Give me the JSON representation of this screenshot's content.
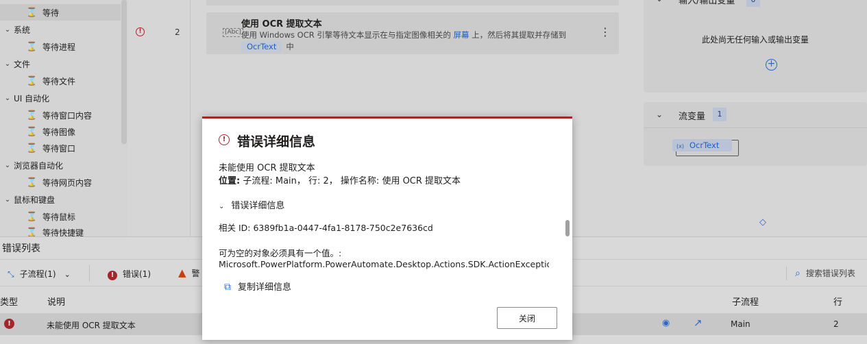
{
  "actions_tree": {
    "items": [
      {
        "type": "item",
        "label": "等待",
        "icon": "hourglass-icon",
        "selected": true
      },
      {
        "type": "category",
        "label": "系统"
      },
      {
        "type": "item",
        "label": "等待进程",
        "icon": "hourglass-icon"
      },
      {
        "type": "category",
        "label": "文件"
      },
      {
        "type": "item",
        "label": "等待文件",
        "icon": "hourglass-icon"
      },
      {
        "type": "category",
        "label": "UI 自动化"
      },
      {
        "type": "item",
        "label": "等待窗口内容",
        "icon": "hourglass-icon"
      },
      {
        "type": "item",
        "label": "等待图像",
        "icon": "hourglass-icon"
      },
      {
        "type": "item",
        "label": "等待窗口",
        "icon": "hourglass-icon"
      },
      {
        "type": "category",
        "label": "浏览器自动化"
      },
      {
        "type": "item",
        "label": "等待网页内容",
        "icon": "hourglass-icon"
      },
      {
        "type": "category",
        "label": "鼠标和键盘"
      },
      {
        "type": "item",
        "label": "等待鼠标",
        "icon": "hourglass-icon"
      },
      {
        "type": "item",
        "label": "等待快捷键",
        "icon": "hourglass-icon"
      }
    ]
  },
  "canvas": {
    "line_number": "2",
    "action": {
      "title": "使用 OCR 提取文本",
      "icon_text": "[Abc]",
      "desc_part1": "使用 Windows OCR 引擎等待文本显示在与指定图像相关的 ",
      "desc_link": "屏幕",
      "desc_part2": " 上，然后将其提取并存储到",
      "desc_var": "OcrText",
      "desc_tail": "中"
    }
  },
  "variables": {
    "io": {
      "title": "输入/输出变量",
      "count": "0",
      "empty_message": "此处尚无任何输入或输出变量"
    },
    "flow": {
      "title": "流变量",
      "count": "1",
      "var_name": "OcrText",
      "var_prefix": "(x)"
    }
  },
  "error_list": {
    "title": "错误列表",
    "toolbar": {
      "subflow": "子流程(1)",
      "errors": "错误(1)",
      "warnings": "警",
      "search_placeholder": "搜索错误列表"
    },
    "columns": {
      "type": "类型",
      "description": "说明",
      "subflow": "子流程",
      "line": "行"
    },
    "rows": [
      {
        "description": "未能使用 OCR 提取文本",
        "subflow": "Main",
        "line": "2"
      }
    ]
  },
  "dialog": {
    "title": "错误详细信息",
    "message": "未能使用 OCR 提取文本",
    "location_label": "位置:",
    "location_value": " 子流程: Main，  行: 2，  操作名称: 使用 OCR 提取文本",
    "section_title": "错误详细信息",
    "correlation": "相关 ID: 6389fb1a-0447-4fa1-8178-750c2e7636cd",
    "detail_line1": "可为空的对象必须具有一个值。:",
    "detail_line2": "Microsoft.PowerPlatform.PowerAutomate.Desktop.Actions.SDK.ActionExceptio",
    "copy_label": "复制详细信息",
    "close_label": "关闭"
  },
  "colors": {
    "error": "#a4262c",
    "accent": "#2b68c8",
    "warning": "#c5400c"
  }
}
